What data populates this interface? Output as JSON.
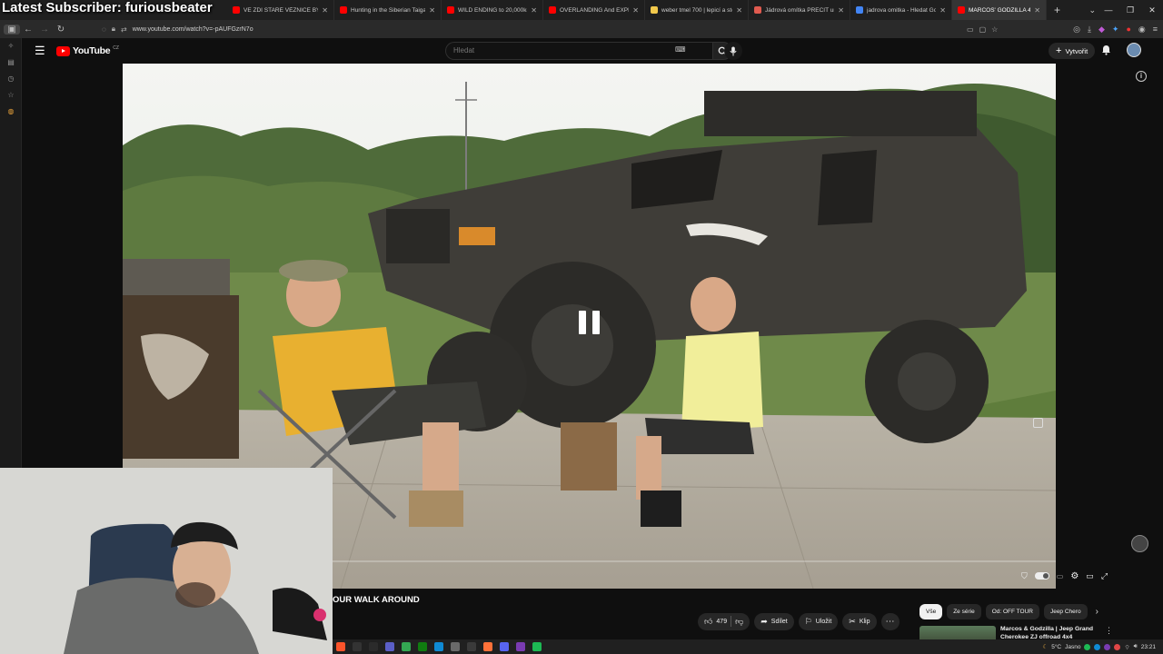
{
  "overlay": {
    "title": "Latest Subscriber: furiousbeater"
  },
  "browser": {
    "tabs": [
      {
        "label": "VE ZDI STARÉ VĚZNICE BYLA DĚ",
        "color": "#ff0000",
        "active": false
      },
      {
        "label": "Hunting in the Siberian Taiga: Y",
        "color": "#ff0000",
        "active": false
      },
      {
        "label": "WILD ENDING to 20,000km Fro",
        "color": "#ff0000",
        "active": false
      },
      {
        "label": "OVERLANDING And EXPLORIN",
        "color": "#ff0000",
        "active": false
      },
      {
        "label": "weber tmel 700 | lepicí a stěrko",
        "color": "#f2c94c",
        "active": false
      },
      {
        "label": "Jádrová omítka PRECIT univerzá",
        "color": "#e05a4f",
        "active": false
      },
      {
        "label": "jadrova omitka - Hledat Googlem",
        "color": "#4285f4",
        "active": false
      },
      {
        "label": "MARCOS' GODZILLA 4x4 1",
        "color": "#ff0000",
        "active": true
      }
    ],
    "new_tab": "+",
    "url": "www.youtube.com/watch?v=-pAUFGzrN7o",
    "window_controls": [
      "—",
      "❐",
      "✕"
    ]
  },
  "youtube": {
    "logo_text": "YouTube",
    "logo_country": "CZ",
    "search_placeholder": "Hledat",
    "create_label": "Vytvořit",
    "video_title": "OUR WALK AROUND",
    "actions": {
      "likes": "479",
      "share": "Sdílet",
      "save": "Uložit",
      "clip": "Klip"
    },
    "chips": [
      "Vše",
      "Ze série",
      "Od: OFF TOUR",
      "Jeep Chero"
    ],
    "recommendation": {
      "title": "Marcos & Godzilla | Jeep Grand Cherokee ZJ offroad 4x4"
    },
    "progress": 0.0
  },
  "taskbar": {
    "weather": "5°C",
    "weather_text": "Jasno",
    "time": "23:21",
    "icons": [
      {
        "name": "brave",
        "color": "#fb542b"
      },
      {
        "name": "app-1",
        "color": "#333333"
      },
      {
        "name": "app-2",
        "color": "#2b2b2b"
      },
      {
        "name": "teams",
        "color": "#5b5fc7"
      },
      {
        "name": "chrome",
        "color": "#34a853"
      },
      {
        "name": "xbox",
        "color": "#107c10"
      },
      {
        "name": "edge",
        "color": "#0f8ad4"
      },
      {
        "name": "app-3",
        "color": "#6a6a6a"
      },
      {
        "name": "obs",
        "color": "#3a3a3a"
      },
      {
        "name": "firefox",
        "color": "#ff7139"
      },
      {
        "name": "discord",
        "color": "#5865f2"
      },
      {
        "name": "app-4",
        "color": "#7a3bb2"
      },
      {
        "name": "spotify",
        "color": "#1db954"
      }
    ]
  }
}
